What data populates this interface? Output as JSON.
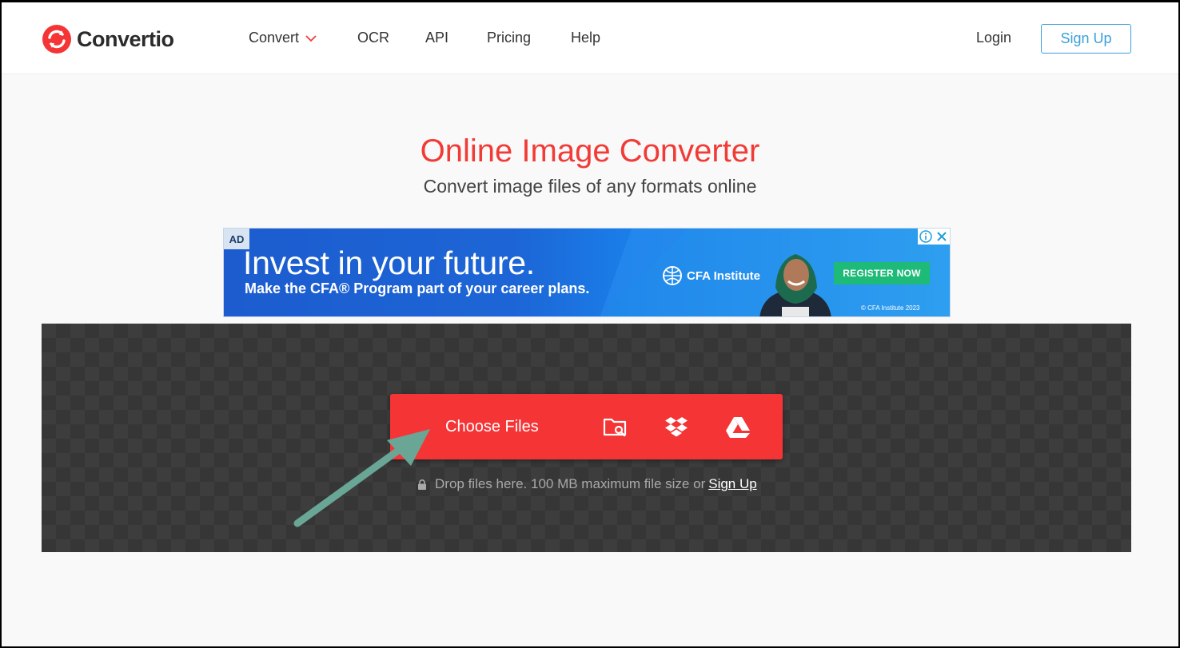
{
  "brand": {
    "name": "Convertio",
    "accent": "#f13b36"
  },
  "nav": {
    "items": [
      {
        "label": "Convert",
        "has_dropdown": true
      },
      {
        "label": "OCR"
      },
      {
        "label": "API"
      },
      {
        "label": "Pricing"
      },
      {
        "label": "Help"
      }
    ],
    "login_label": "Login",
    "signup_label": "Sign Up"
  },
  "hero": {
    "title": "Online Image Converter",
    "subtitle": "Convert image files of any formats online"
  },
  "ad": {
    "tag": "AD",
    "headline": "Invest in your future.",
    "subline": "Make the CFA® Program part of your career plans.",
    "brand": "CFA Institute",
    "cta": "REGISTER NOW",
    "copyright": "© CFA Institute 2023"
  },
  "upload": {
    "choose_label": "Choose Files",
    "sources": [
      "folder-search-icon",
      "dropbox-icon",
      "google-drive-icon"
    ],
    "note_text": "Drop files here. 100 MB maximum file size or",
    "note_link": "Sign Up"
  }
}
